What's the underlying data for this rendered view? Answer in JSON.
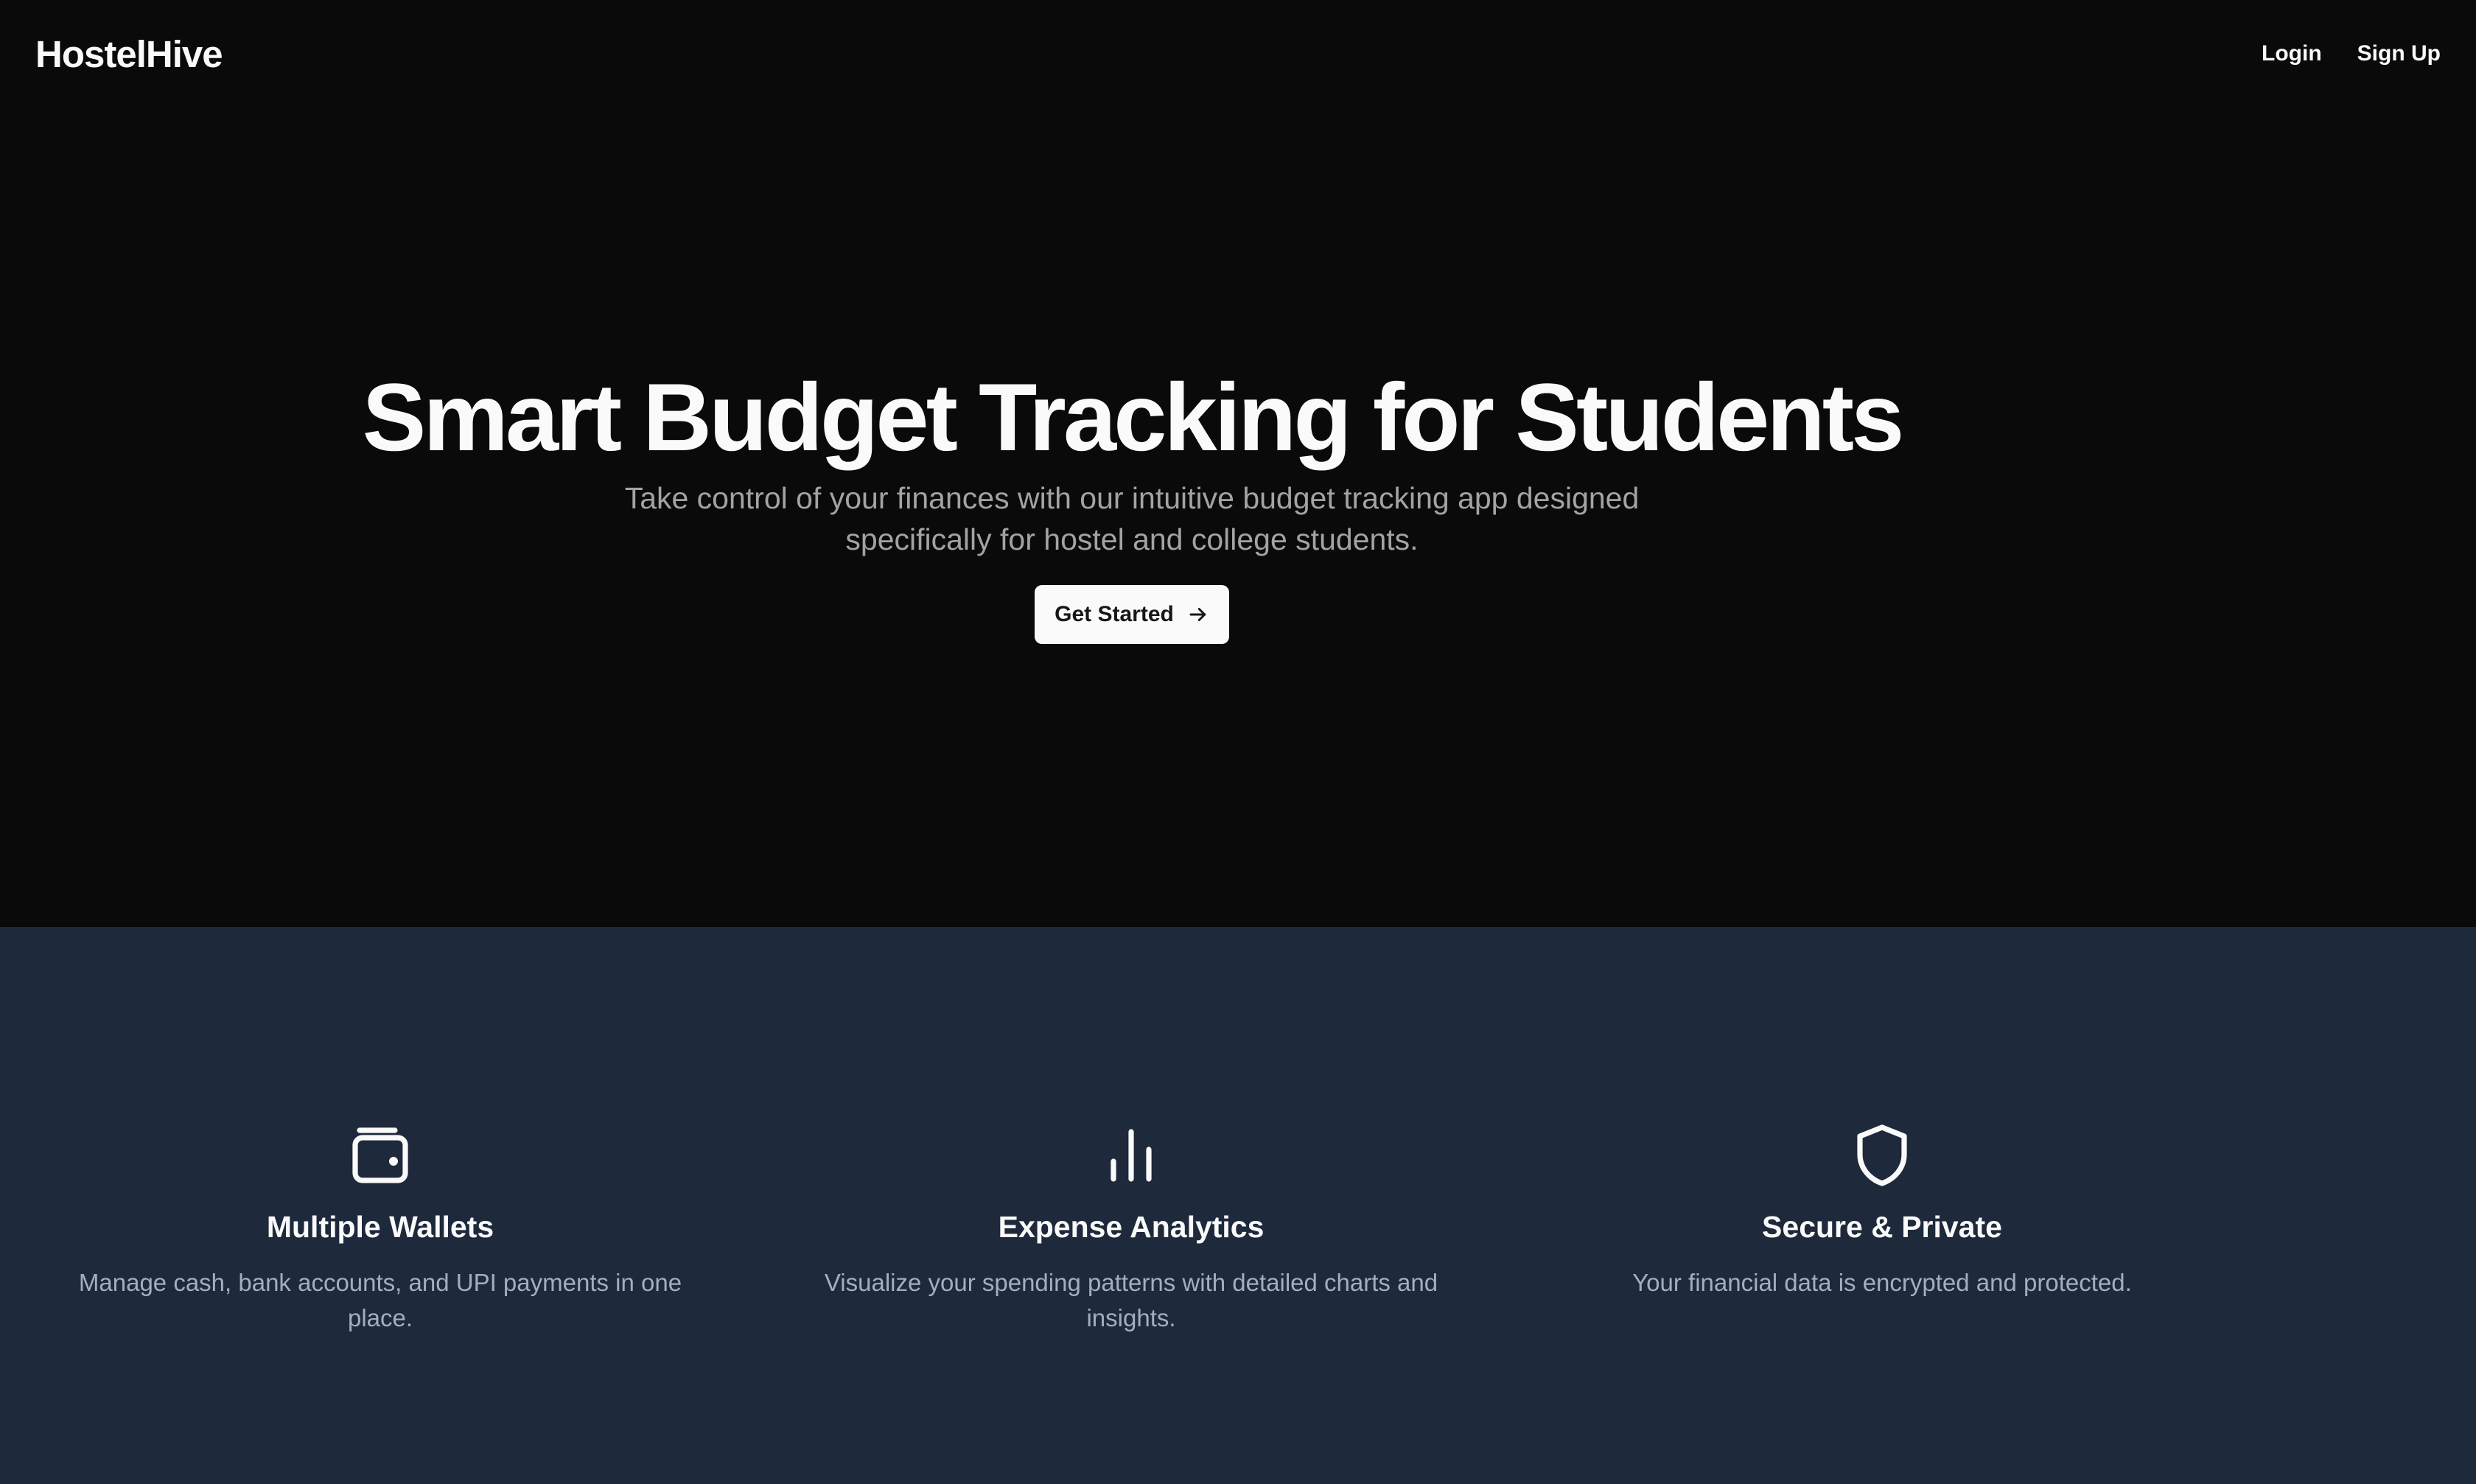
{
  "header": {
    "brand": "HostelHive",
    "nav": {
      "login": "Login",
      "signup": "Sign Up"
    }
  },
  "hero": {
    "title": "Smart Budget Tracking for Students",
    "subtitle": "Take control of your finances with our intuitive budget tracking app designed specifically for hostel and college students.",
    "cta_label": "Get Started",
    "cta_icon": "arrow-right-icon"
  },
  "features": [
    {
      "icon": "wallet-icon",
      "title": "Multiple Wallets",
      "description": "Manage cash, bank accounts, and UPI payments in one place."
    },
    {
      "icon": "bar-chart-icon",
      "title": "Expense Analytics",
      "description": "Visualize your spending patterns with detailed charts and insights."
    },
    {
      "icon": "shield-icon",
      "title": "Secure & Private",
      "description": "Your financial data is encrypted and protected."
    }
  ],
  "colors": {
    "hero_background": "#0a0a0a",
    "features_background": "#1e293b",
    "text_primary": "#fafafa",
    "text_muted": "#a3a3a3",
    "button_background": "#fafafa",
    "button_text": "#171717"
  }
}
